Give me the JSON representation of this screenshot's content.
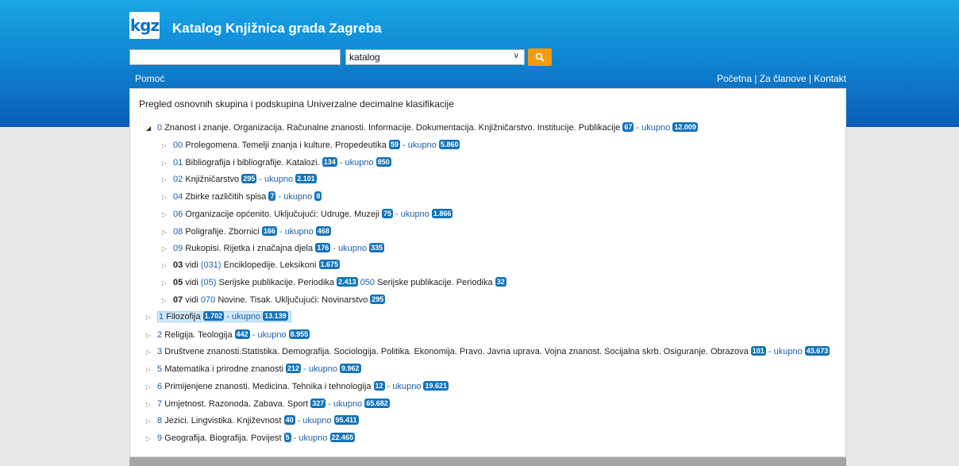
{
  "header": {
    "logo_text": "kgz",
    "title": "Katalog Knjižnica grada Zagreba",
    "search_placeholder": "",
    "select_value": "katalog",
    "help": "Pomoć",
    "links": [
      "Početna",
      "Za članove",
      "Kontakt"
    ],
    "separator": " | "
  },
  "panel": {
    "title": "Pregled osnovnih skupina i podskupina Univerzalne decimalne klasifikacije",
    "total_label": "ukupno",
    "vidi_label": "vidi"
  },
  "tree": [
    {
      "code": "0",
      "text": "Znanost i znanje. Organizacija. Računalne znanosti. Informacije. Dokumentacija. Knjižničarstvo. Institucije. Publikacije",
      "count": "67",
      "total": "12.009"
    },
    {
      "code": "00",
      "text": "Prolegomena. Temelji znanja i kulture. Propedeutika",
      "count": "59",
      "total": "5.860"
    },
    {
      "code": "01",
      "text": "Bibliografija i bibliografije. Katalozi.",
      "count": "134",
      "total": "850"
    },
    {
      "code": "02",
      "text": "Knjižničarstvo",
      "count": "295",
      "total": "2.101"
    },
    {
      "code": "04",
      "text": "Zbirke različitih spisa",
      "count": "7",
      "total": "8"
    },
    {
      "code": "06",
      "text": "Organizacije općenito. Uključujući: Udruge. Muzeji",
      "count": "75",
      "total": "1.866"
    },
    {
      "code": "08",
      "text": "Poligrafije. Zbornici",
      "count": "166",
      "total": "468"
    },
    {
      "code": "09",
      "text": "Rukopisi. Rijetka i značajna djela",
      "count": "176",
      "total": "335"
    },
    {
      "bold": "03",
      "ref": "(031)",
      "text": "Enciklopedije. Leksikoni",
      "count": "1.675"
    },
    {
      "bold": "05",
      "ref": "(05)",
      "text": "Serijske publikacije. Periodika",
      "count": "2.413",
      "ref2": "050",
      "text2": "Serijske publikacije. Periodika",
      "count2": "32"
    },
    {
      "bold": "07",
      "ref": "070",
      "text": "Novine. Tisak. Uključujući: Novinarstvo",
      "count": "295"
    },
    {
      "code": "1",
      "text": "Filozofija",
      "count": "1.702",
      "total": "13.139"
    },
    {
      "code": "2",
      "text": "Religija. Teologija",
      "count": "442",
      "total": "8.955"
    },
    {
      "code": "3",
      "text": "Društvene znanosti.Statistika. Demografija. Sociologija. Politika. Ekonomija. Pravo. Javna uprava. Vojna znanost. Socijalna skrb. Osiguranje. Obrazova",
      "count": "101",
      "total": "43.673"
    },
    {
      "code": "5",
      "text": "Matematika i prirodne znanosti",
      "count": "212",
      "total": "9.962"
    },
    {
      "code": "6",
      "text": "Primijenjene znanosti. Medicina. Tehnika i tehnologija",
      "count": "12",
      "total": "19.621"
    },
    {
      "code": "7",
      "text": "Umjetnost. Razonoda. Zabava. Sport",
      "count": "327",
      "total": "65.682"
    },
    {
      "code": "8",
      "text": "Jezici. Lingvistika. Književnost",
      "count": "40",
      "total": "95.411"
    },
    {
      "code": "9",
      "text": "Geografija. Biografija. Povijest",
      "count": "5",
      "total": "22.465"
    }
  ]
}
